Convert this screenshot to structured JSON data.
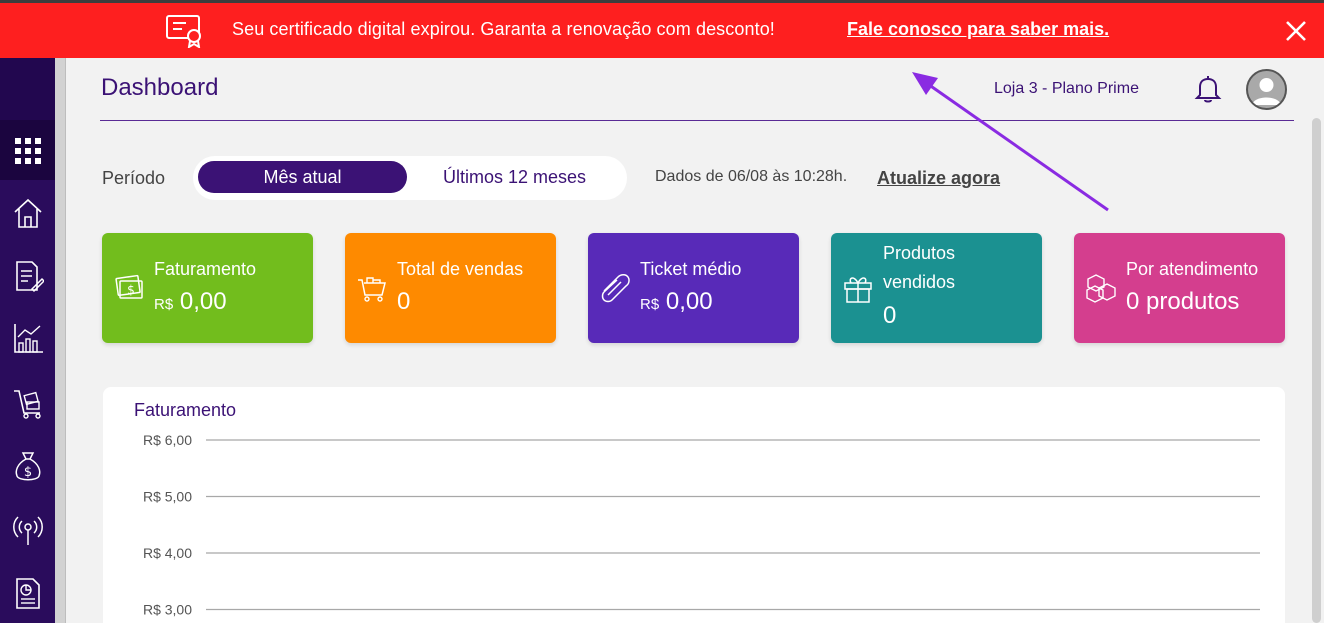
{
  "banner": {
    "message": "Seu certificado digital expirou. Garanta a renovação com desconto!",
    "link": "Fale conosco para saber mais.",
    "bg_color": "#fe1f1f"
  },
  "header": {
    "title": "Dashboard",
    "store": "Loja 3 - Plano Prime"
  },
  "sidebar": {
    "icons": [
      "apps-grid-icon",
      "home-icon",
      "document-edit-icon",
      "bar-chart-icon",
      "cart-box-icon",
      "money-bag-icon",
      "broadcast-icon",
      "report-icon"
    ]
  },
  "period": {
    "label": "Período",
    "options": [
      "Mês atual",
      "Últimos 12 meses"
    ],
    "selected": "Mês atual",
    "info": "Dados de 06/08 às 10:28h.",
    "update_link": "Atualize agora"
  },
  "cards": [
    {
      "title": "Faturamento",
      "currency": "R$",
      "value": "0,00",
      "color": "#72bd1d",
      "icon": "cash-icon"
    },
    {
      "title": "Total de vendas",
      "currency": "",
      "value": "0",
      "color": "#fe8a00",
      "icon": "cart-icon"
    },
    {
      "title": "Ticket médio",
      "currency": "R$",
      "value": "0,00",
      "color": "#582ab8",
      "icon": "ticket-icon"
    },
    {
      "title_line1": "Produtos",
      "title_line2": "vendidos",
      "currency": "",
      "value": "0",
      "color": "#1b9191",
      "icon": "gift-icon"
    },
    {
      "title": "Por atendimento",
      "currency": "",
      "value": "0 produtos",
      "color": "#d43e8e",
      "icon": "boxes-icon"
    }
  ],
  "chart_data": {
    "type": "line",
    "title": "Faturamento",
    "y_ticks": [
      "R$ 6,00",
      "R$ 5,00",
      "R$ 4,00",
      "R$ 3,00"
    ],
    "y_values": [
      6,
      5,
      4,
      3
    ],
    "ylim_visible": [
      3,
      6
    ],
    "series": [],
    "grid": true
  },
  "colors": {
    "brand": "#3b1275",
    "sidebar": "#2a0c5c",
    "arrow": "#8a2be2"
  }
}
